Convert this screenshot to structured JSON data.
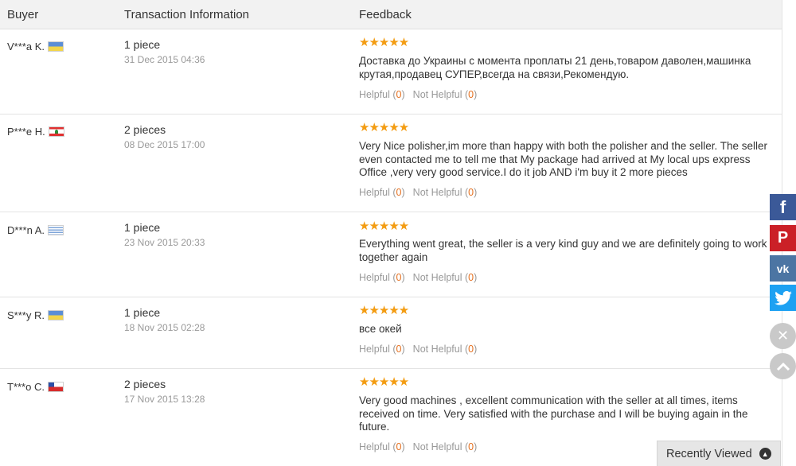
{
  "header": {
    "buyer": "Buyer",
    "transaction": "Transaction Information",
    "feedback": "Feedback"
  },
  "reviews": [
    {
      "buyer": "V***a K.",
      "flag": "ukraine-flag",
      "qty": "1 piece",
      "date": "31 Dec 2015 04:36",
      "stars": "★★★★★",
      "text": "Доставка до Украины с момента проплаты 21 день,товаром даволен,машинка крутая,продавец СУПЕР,всегда на связи,Рекомендую.",
      "helpful_label": "Helpful (",
      "helpful_count": "0",
      "not_helpful_label": "Not Helpful (",
      "not_helpful_count": "0",
      "close": ")"
    },
    {
      "buyer": "P***e H.",
      "flag": "lebanon-flag",
      "qty": "2 pieces",
      "date": "08 Dec 2015 17:00",
      "stars": "★★★★★",
      "text": "Very Nice polisher,im more than happy with both the polisher and the seller. The seller even contacted me to tell me that My package had arrived at My local ups express Office ,very very good service.I do it job AND i'm buy it 2 more pieces",
      "helpful_label": "Helpful (",
      "helpful_count": "0",
      "not_helpful_label": "Not Helpful (",
      "not_helpful_count": "0",
      "close": ")"
    },
    {
      "buyer": "D***n A.",
      "flag": "uruguay-flag",
      "qty": "1 piece",
      "date": "23 Nov 2015 20:33",
      "stars": "★★★★★",
      "text": "Everything went great, the seller is a very kind guy and we are definitely going to work together again",
      "helpful_label": "Helpful (",
      "helpful_count": "0",
      "not_helpful_label": "Not Helpful (",
      "not_helpful_count": "0",
      "close": ")"
    },
    {
      "buyer": "S***y R.",
      "flag": "ukraine-flag",
      "qty": "1 piece",
      "date": "18 Nov 2015 02:28",
      "stars": "★★★★★",
      "text": "все окей",
      "helpful_label": "Helpful (",
      "helpful_count": "0",
      "not_helpful_label": "Not Helpful (",
      "not_helpful_count": "0",
      "close": ")"
    },
    {
      "buyer": "T***o C.",
      "flag": "chile-flag",
      "qty": "2 pieces",
      "date": "17 Nov 2015 13:28",
      "stars": "★★★★★",
      "text": "Very good machines , excellent communication with the seller at all times, items received on time. Very satisfied with the purchase and I will be buying again in the future.",
      "helpful_label": "Helpful (",
      "helpful_count": "0",
      "not_helpful_label": "Not Helpful (",
      "not_helpful_count": "0",
      "close": ")"
    }
  ],
  "social": {
    "facebook": "f",
    "pinterest": "P",
    "vk": "vk",
    "twitter": "t"
  },
  "recently_viewed": "Recently Viewed",
  "colors": {
    "star": "#f39c12",
    "count": "#e5701f",
    "facebook": "#3b5998",
    "pinterest": "#cb2027",
    "vk": "#4c75a3",
    "twitter": "#1da1f2"
  }
}
